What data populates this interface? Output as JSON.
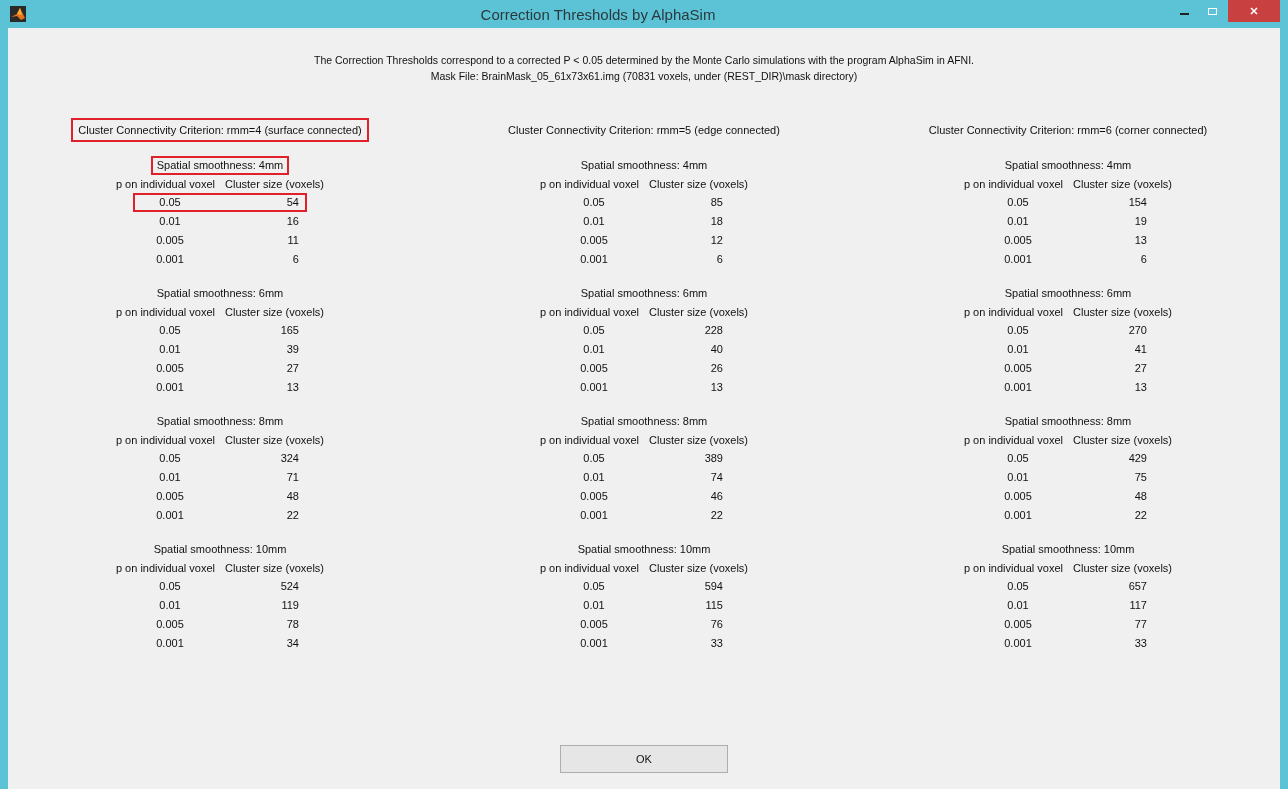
{
  "window": {
    "title": "Correction Thresholds by AlphaSim"
  },
  "intro": [
    "The Correction Thresholds correspond to a corrected P < 0.05 determined by the Monte Carlo simulations with the program AlphaSim in AFNI.",
    "Mask File: BrainMask_05_61x73x61.img (70831 voxels, under (REST_DIR)\\mask directory)"
  ],
  "columns": [
    {
      "criterion": "Cluster Connectivity Criterion: rmm=4 (surface connected)",
      "highlighted": true,
      "groups": [
        {
          "title": "Spatial smoothness: 4mm",
          "highlighted": true,
          "headers": [
            "p on individual voxel",
            "Cluster size (voxels)"
          ],
          "rows": [
            {
              "p": "0.05",
              "size": "54",
              "highlighted": true
            },
            {
              "p": "0.01",
              "size": "16",
              "highlighted": false
            },
            {
              "p": "0.005",
              "size": "11",
              "highlighted": false
            },
            {
              "p": "0.001",
              "size": "6",
              "highlighted": false
            }
          ]
        },
        {
          "title": "Spatial smoothness: 6mm",
          "highlighted": false,
          "headers": [
            "p on individual voxel",
            "Cluster size (voxels)"
          ],
          "rows": [
            {
              "p": "0.05",
              "size": "165",
              "highlighted": false
            },
            {
              "p": "0.01",
              "size": "39",
              "highlighted": false
            },
            {
              "p": "0.005",
              "size": "27",
              "highlighted": false
            },
            {
              "p": "0.001",
              "size": "13",
              "highlighted": false
            }
          ]
        },
        {
          "title": "Spatial smoothness: 8mm",
          "highlighted": false,
          "headers": [
            "p on individual voxel",
            "Cluster size (voxels)"
          ],
          "rows": [
            {
              "p": "0.05",
              "size": "324",
              "highlighted": false
            },
            {
              "p": "0.01",
              "size": "71",
              "highlighted": false
            },
            {
              "p": "0.005",
              "size": "48",
              "highlighted": false
            },
            {
              "p": "0.001",
              "size": "22",
              "highlighted": false
            }
          ]
        },
        {
          "title": "Spatial smoothness: 10mm",
          "highlighted": false,
          "headers": [
            "p on individual voxel",
            "Cluster size (voxels)"
          ],
          "rows": [
            {
              "p": "0.05",
              "size": "524",
              "highlighted": false
            },
            {
              "p": "0.01",
              "size": "119",
              "highlighted": false
            },
            {
              "p": "0.005",
              "size": "78",
              "highlighted": false
            },
            {
              "p": "0.001",
              "size": "34",
              "highlighted": false
            }
          ]
        }
      ]
    },
    {
      "criterion": "Cluster Connectivity Criterion: rmm=5 (edge connected)",
      "highlighted": false,
      "groups": [
        {
          "title": "Spatial smoothness: 4mm",
          "highlighted": false,
          "headers": [
            "p on individual voxel",
            "Cluster size (voxels)"
          ],
          "rows": [
            {
              "p": "0.05",
              "size": "85",
              "highlighted": false
            },
            {
              "p": "0.01",
              "size": "18",
              "highlighted": false
            },
            {
              "p": "0.005",
              "size": "12",
              "highlighted": false
            },
            {
              "p": "0.001",
              "size": "6",
              "highlighted": false
            }
          ]
        },
        {
          "title": "Spatial smoothness: 6mm",
          "highlighted": false,
          "headers": [
            "p on individual voxel",
            "Cluster size (voxels)"
          ],
          "rows": [
            {
              "p": "0.05",
              "size": "228",
              "highlighted": false
            },
            {
              "p": "0.01",
              "size": "40",
              "highlighted": false
            },
            {
              "p": "0.005",
              "size": "26",
              "highlighted": false
            },
            {
              "p": "0.001",
              "size": "13",
              "highlighted": false
            }
          ]
        },
        {
          "title": "Spatial smoothness: 8mm",
          "highlighted": false,
          "headers": [
            "p on individual voxel",
            "Cluster size (voxels)"
          ],
          "rows": [
            {
              "p": "0.05",
              "size": "389",
              "highlighted": false
            },
            {
              "p": "0.01",
              "size": "74",
              "highlighted": false
            },
            {
              "p": "0.005",
              "size": "46",
              "highlighted": false
            },
            {
              "p": "0.001",
              "size": "22",
              "highlighted": false
            }
          ]
        },
        {
          "title": "Spatial smoothness: 10mm",
          "highlighted": false,
          "headers": [
            "p on individual voxel",
            "Cluster size (voxels)"
          ],
          "rows": [
            {
              "p": "0.05",
              "size": "594",
              "highlighted": false
            },
            {
              "p": "0.01",
              "size": "115",
              "highlighted": false
            },
            {
              "p": "0.005",
              "size": "76",
              "highlighted": false
            },
            {
              "p": "0.001",
              "size": "33",
              "highlighted": false
            }
          ]
        }
      ]
    },
    {
      "criterion": "Cluster Connectivity Criterion: rmm=6 (corner connected)",
      "highlighted": false,
      "groups": [
        {
          "title": "Spatial smoothness: 4mm",
          "highlighted": false,
          "headers": [
            "p on individual voxel",
            "Cluster size (voxels)"
          ],
          "rows": [
            {
              "p": "0.05",
              "size": "154",
              "highlighted": false
            },
            {
              "p": "0.01",
              "size": "19",
              "highlighted": false
            },
            {
              "p": "0.005",
              "size": "13",
              "highlighted": false
            },
            {
              "p": "0.001",
              "size": "6",
              "highlighted": false
            }
          ]
        },
        {
          "title": "Spatial smoothness: 6mm",
          "highlighted": false,
          "headers": [
            "p on individual voxel",
            "Cluster size (voxels)"
          ],
          "rows": [
            {
              "p": "0.05",
              "size": "270",
              "highlighted": false
            },
            {
              "p": "0.01",
              "size": "41",
              "highlighted": false
            },
            {
              "p": "0.005",
              "size": "27",
              "highlighted": false
            },
            {
              "p": "0.001",
              "size": "13",
              "highlighted": false
            }
          ]
        },
        {
          "title": "Spatial smoothness: 8mm",
          "highlighted": false,
          "headers": [
            "p on individual voxel",
            "Cluster size (voxels)"
          ],
          "rows": [
            {
              "p": "0.05",
              "size": "429",
              "highlighted": false
            },
            {
              "p": "0.01",
              "size": "75",
              "highlighted": false
            },
            {
              "p": "0.005",
              "size": "48",
              "highlighted": false
            },
            {
              "p": "0.001",
              "size": "22",
              "highlighted": false
            }
          ]
        },
        {
          "title": "Spatial smoothness: 10mm",
          "highlighted": false,
          "headers": [
            "p on individual voxel",
            "Cluster size (voxels)"
          ],
          "rows": [
            {
              "p": "0.05",
              "size": "657",
              "highlighted": false
            },
            {
              "p": "0.01",
              "size": "117",
              "highlighted": false
            },
            {
              "p": "0.005",
              "size": "77",
              "highlighted": false
            },
            {
              "p": "0.001",
              "size": "33",
              "highlighted": false
            }
          ]
        }
      ]
    }
  ],
  "ok_button": "OK"
}
